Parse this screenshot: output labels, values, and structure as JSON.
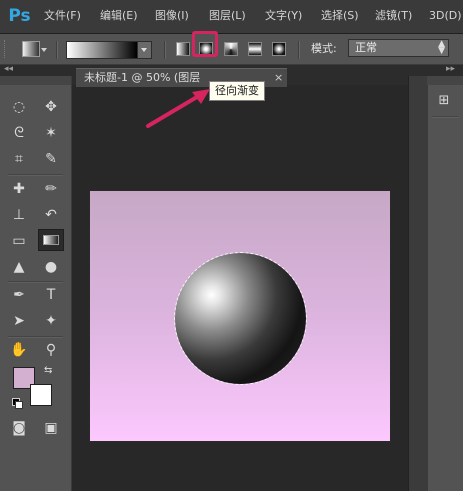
{
  "app": {
    "logo": "Ps"
  },
  "menu": [
    {
      "label": "文件(F)"
    },
    {
      "label": "编辑(E)"
    },
    {
      "label": "图像(I)"
    },
    {
      "label": "图层(L)"
    },
    {
      "label": "文字(Y)"
    },
    {
      "label": "选择(S)"
    },
    {
      "label": "滤镜(T)"
    },
    {
      "label": "3D(D)"
    }
  ],
  "options_bar": {
    "mode_label": "模式:",
    "mode_value": "正常",
    "gradient_types": [
      "linear-gradient-icon",
      "radial-gradient-icon",
      "angle-gradient-icon",
      "reflected-gradient-icon",
      "diamond-gradient-icon"
    ],
    "selected_gradient_type": "radial",
    "tooltip": "径向渐变"
  },
  "document": {
    "tab_title": "未标题-1 @ 50% (图层",
    "close_glyph": "×"
  },
  "tools": {
    "type_tool_glyph": "T"
  },
  "colors": {
    "accent_highlight": "#d6245f",
    "foreground": "#d3b0d0",
    "background": "#ffffff",
    "canvas_top": "#c6a8c6",
    "canvas_bottom": "#fcc8fe",
    "ps_blue": "#34a7e0"
  },
  "collapse": {
    "left": "◂◂",
    "right": "▸▸"
  }
}
